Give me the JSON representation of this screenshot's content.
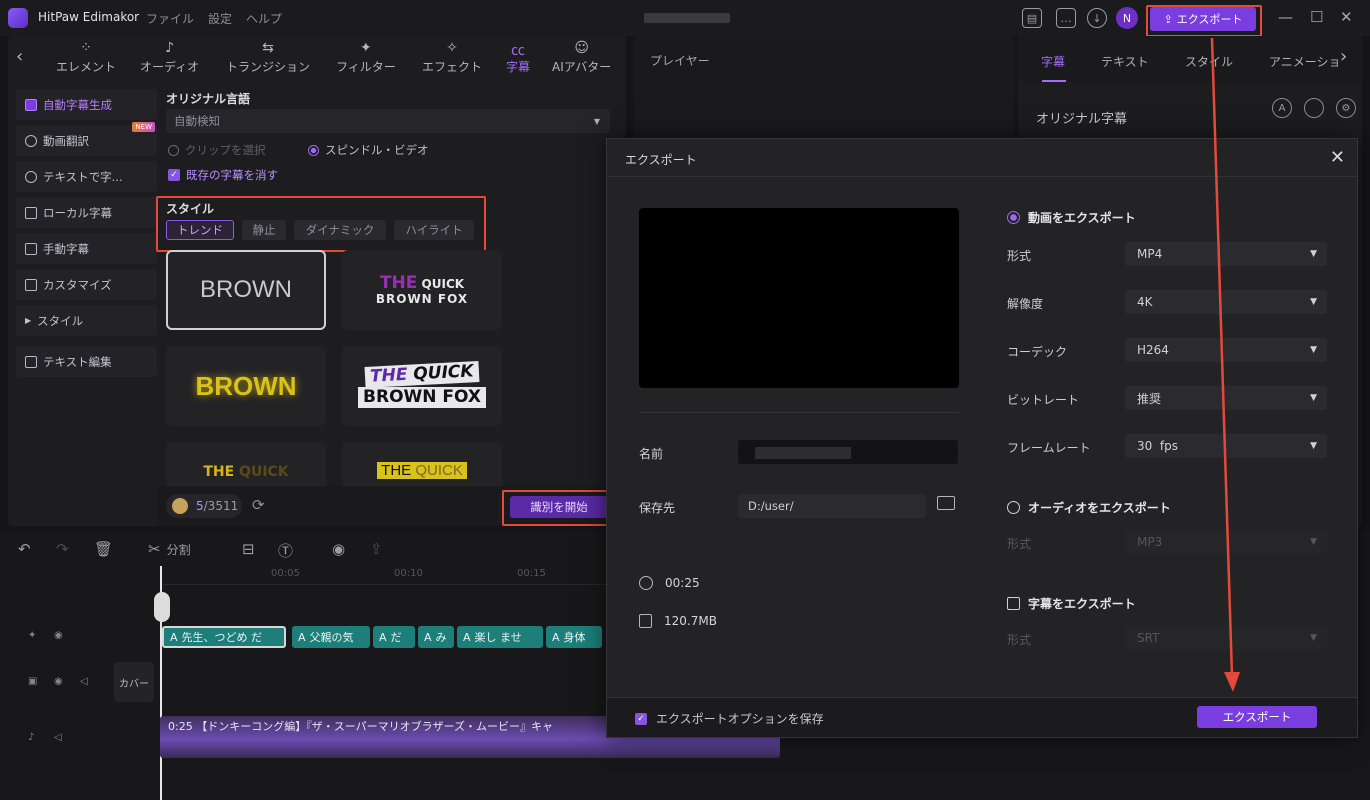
{
  "titlebar": {
    "app_name": "HitPaw Edimakor",
    "menu": [
      "ファイル",
      "設定",
      "ヘルプ"
    ],
    "avatar_letter": "N",
    "export_label": "エクスポート"
  },
  "toptabs": [
    {
      "label": "エレメント",
      "icon": "element-icon"
    },
    {
      "label": "オーディオ",
      "icon": "music-note-icon"
    },
    {
      "label": "トランジション",
      "icon": "transition-icon"
    },
    {
      "label": "フィルター",
      "icon": "filter-icon"
    },
    {
      "label": "エフェクト",
      "icon": "effect-icon"
    },
    {
      "label": "字幕",
      "icon": "subtitle-icon",
      "active": true
    },
    {
      "label": "AIアバター",
      "icon": "ai-avatar-icon"
    }
  ],
  "sidebar": {
    "items": [
      {
        "label": "自動字幕生成",
        "active": true
      },
      {
        "label": "動画翻訳",
        "badge": "NEW"
      },
      {
        "label": "テキストで字..."
      },
      {
        "label": "ローカル字幕"
      },
      {
        "label": "手動字幕"
      },
      {
        "label": "カスタマイズ"
      },
      {
        "label": "スタイル"
      },
      {
        "label": "テキスト編集"
      }
    ]
  },
  "subtitle_panel": {
    "language_label": "オリジナル言語",
    "language_value": "自動検知",
    "radio_clip": "クリップを選択",
    "radio_video": "スピンドル・ビデオ",
    "clear_existing": "既存の字幕を消す",
    "style_label": "スタイル",
    "style_buttons": [
      "トレンド",
      "静止",
      "ダイナミック",
      "ハイライト"
    ],
    "cards": {
      "c1": "BROWN",
      "c2_line1_a": "THE",
      "c2_line1_b": "QUICK",
      "c2_line2": "BROWN FOX",
      "c3": "BROWN",
      "c4_line1_a": "THE",
      "c4_line1_b": "QUICK",
      "c4_line2": "BROWN FOX",
      "c5_a": "THE",
      "c5_b": "QUICK",
      "c6_a": "THE",
      "c6_b": "QUICK"
    },
    "credits_used": "5",
    "credits_total": "/3511",
    "start_button": "識別を開始"
  },
  "player": {
    "label": "プレイヤー"
  },
  "right_panel": {
    "tabs": [
      "字幕",
      "テキスト",
      "スタイル",
      "アニメーショ"
    ],
    "original_subtitle": "オリジナル字幕"
  },
  "timeline": {
    "split_label": "分割",
    "ticks": [
      "00:05",
      "00:10",
      "00:15"
    ],
    "clips": [
      "先生、つどめ だ",
      "父親の気",
      "だ",
      "み",
      "楽し ませ",
      "身体"
    ],
    "cover_label": "カバー",
    "audio_label": "0:25 【ドンキーコング編】『ザ・スーパーマリオブラザーズ・ムービー』キャ"
  },
  "export_dialog": {
    "title": "エクスポート",
    "name_label": "名前",
    "path_label": "保存先",
    "path_value": "D:/user/",
    "duration": "00:25",
    "filesize": "120.7MB",
    "video_export": "動画をエクスポート",
    "format_label": "形式",
    "format_value": "MP4",
    "resolution_label": "解像度",
    "resolution_value": "4K",
    "codec_label": "コーデック",
    "codec_value": "H264",
    "bitrate_label": "ビットレート",
    "bitrate_value": "推奨",
    "framerate_label": "フレームレート",
    "framerate_value": "30  fps",
    "audio_export": "オーディオをエクスポート",
    "audio_format_label": "形式",
    "audio_format_value": "MP3",
    "subtitle_export": "字幕をエクスポート",
    "subtitle_format_label": "形式",
    "subtitle_format_value": "SRT",
    "save_options": "エクスポートオプションを保存",
    "export_button": "エクスポート"
  },
  "colors": {
    "accent": "#7a3ee0",
    "annotation": "#e24a3b",
    "clip": "#1e7f7a"
  }
}
